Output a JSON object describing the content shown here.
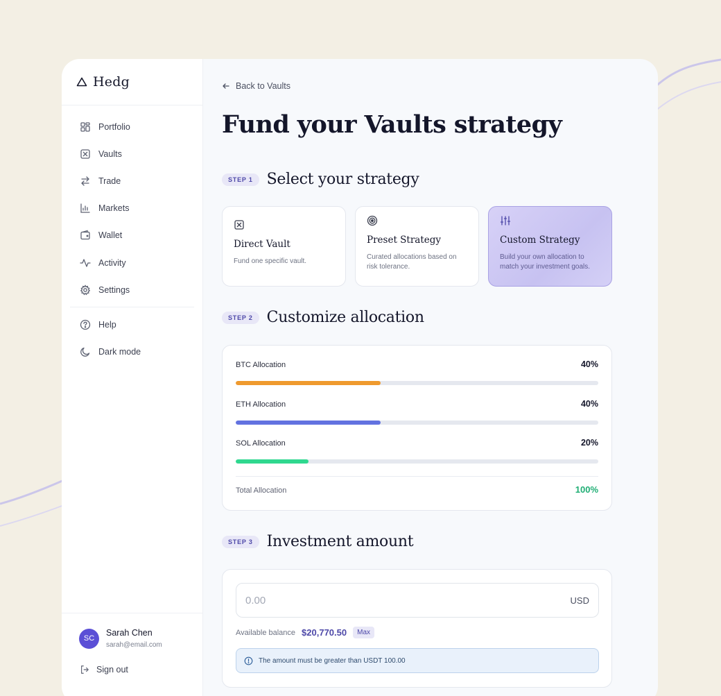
{
  "brand": {
    "name": "Hedg"
  },
  "sidebar": {
    "items": [
      {
        "label": "Portfolio",
        "icon": "grid-icon"
      },
      {
        "label": "Vaults",
        "icon": "vault-icon"
      },
      {
        "label": "Trade",
        "icon": "swap-arrows-icon"
      },
      {
        "label": "Markets",
        "icon": "bar-chart-icon"
      },
      {
        "label": "Wallet",
        "icon": "wallet-icon"
      },
      {
        "label": "Activity",
        "icon": "pulse-icon"
      },
      {
        "label": "Settings",
        "icon": "gear-icon"
      }
    ],
    "secondary": [
      {
        "label": "Help",
        "icon": "help-circle-icon"
      },
      {
        "label": "Dark mode",
        "icon": "moon-icon"
      }
    ]
  },
  "user": {
    "initials": "SC",
    "name": "Sarah Chen",
    "email": "sarah@email.com",
    "signout_label": "Sign out"
  },
  "header": {
    "back_label": "Back to Vaults",
    "title": "Fund your Vaults strategy"
  },
  "step1": {
    "badge": "STEP 1",
    "title": "Select your strategy",
    "cards": [
      {
        "title": "Direct Vault",
        "desc": "Fund one specific vault.",
        "icon": "vault-icon",
        "selected": false
      },
      {
        "title": "Preset Strategy",
        "desc": "Curated allocations based on risk tolerance.",
        "icon": "target-icon",
        "selected": false
      },
      {
        "title": "Custom Strategy",
        "desc": "Build your own allocation to match your investment goals.",
        "icon": "sliders-icon",
        "selected": true
      }
    ]
  },
  "step2": {
    "badge": "STEP 2",
    "title": "Customize allocation",
    "allocations": [
      {
        "label": "BTC Allocation",
        "pct": "40%",
        "value": 40,
        "color": "#ef9a2e"
      },
      {
        "label": "ETH Allocation",
        "pct": "40%",
        "value": 40,
        "color": "#6272e0"
      },
      {
        "label": "SOL Allocation",
        "pct": "20%",
        "value": 20,
        "color": "#2fd88f"
      }
    ],
    "total_label": "Total Allocation",
    "total_pct": "100%"
  },
  "step3": {
    "badge": "STEP 3",
    "title": "Investment amount",
    "amount_placeholder": "0.00",
    "currency": "USD",
    "balance_label": "Available balance",
    "balance_value": "$20,770.50",
    "max_label": "Max",
    "notice": "The amount must be greater than USDT 100.00"
  },
  "colors": {
    "accent": "#4d48a8",
    "avatar": "#5b4fd6",
    "success": "#1fae74"
  }
}
